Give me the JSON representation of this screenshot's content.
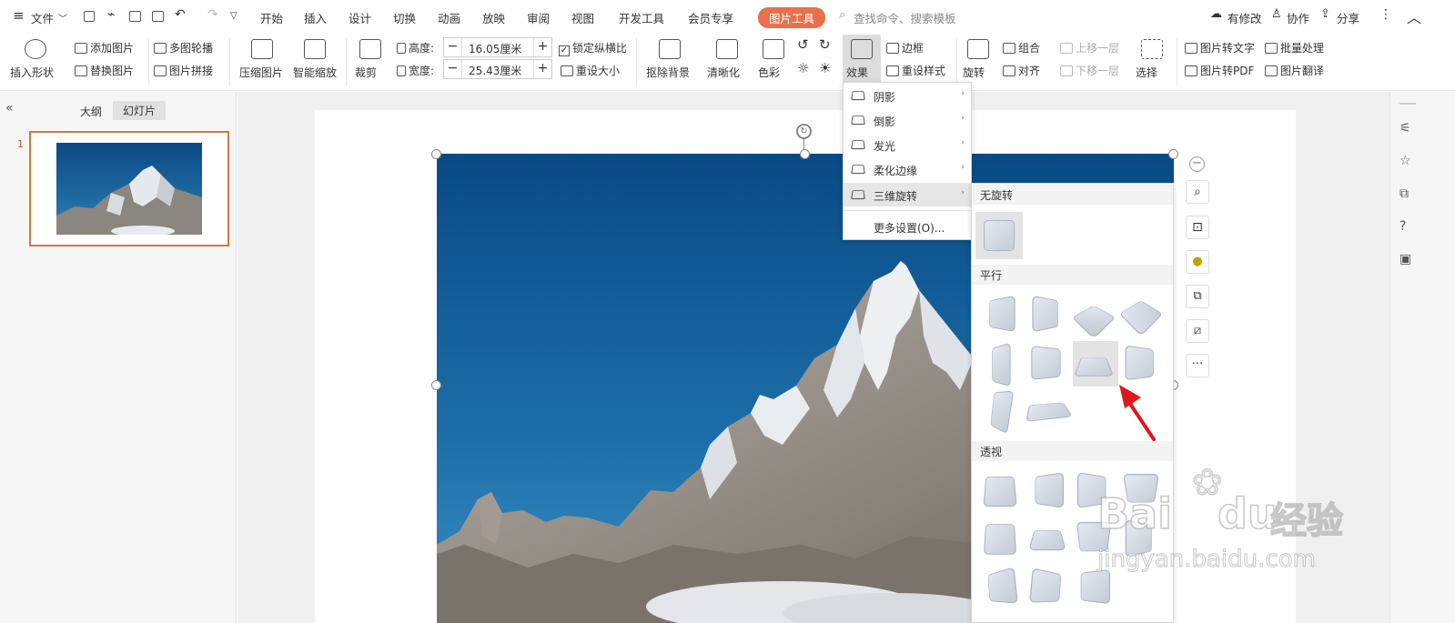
{
  "menu": {
    "file": "文件",
    "tabs": [
      "开始",
      "插入",
      "设计",
      "切换",
      "动画",
      "放映",
      "审阅",
      "视图",
      "开发工具",
      "会员专享"
    ],
    "picture_tools": "图片工具",
    "search_placeholder": "查找命令、搜索模板",
    "modified": "有修改",
    "collab": "协作",
    "share": "分享",
    "accent_color": "#e8704a"
  },
  "ribbon": {
    "insert_shape": "插入形状",
    "add_picture": "添加图片",
    "replace_picture": "替换图片",
    "multi_carousel": "多图轮播",
    "picture_collage": "图片拼接",
    "compress": "压缩图片",
    "smart_zoom": "智能缩放",
    "crop": "裁剪",
    "height_label": "高度:",
    "height_value": "16.05厘米",
    "width_label": "宽度:",
    "width_value": "25.43厘米",
    "lock_ratio": "锁定纵横比",
    "reset_size": "重设大小",
    "remove_bg": "抠除背景",
    "sharpen": "清晰化",
    "color": "色彩",
    "effects": "效果",
    "border": "边框",
    "reset_style": "重设样式",
    "rotate": "旋转",
    "group": "组合",
    "align": "对齐",
    "bring_forward": "上移一层",
    "send_backward": "下移一层",
    "select": "选择",
    "pic_to_text": "图片转文字",
    "batch": "批量处理",
    "pic_to_pdf": "图片转PDF",
    "pic_translate": "图片翻译"
  },
  "panel": {
    "outline_tab": "大纲",
    "slides_tab": "幻灯片",
    "slide_number": "1"
  },
  "effects_menu": {
    "items": [
      "阴影",
      "倒影",
      "发光",
      "柔化边缘",
      "三维旋转"
    ],
    "more": "更多设置(O)..."
  },
  "rotation_submenu": {
    "none": "无旋转",
    "parallel": "平行",
    "perspective": "透视"
  },
  "watermark": {
    "brand": "Bai",
    "brand2": "du",
    "suffix": "经验",
    "url": "jingyan.baidu.com"
  }
}
